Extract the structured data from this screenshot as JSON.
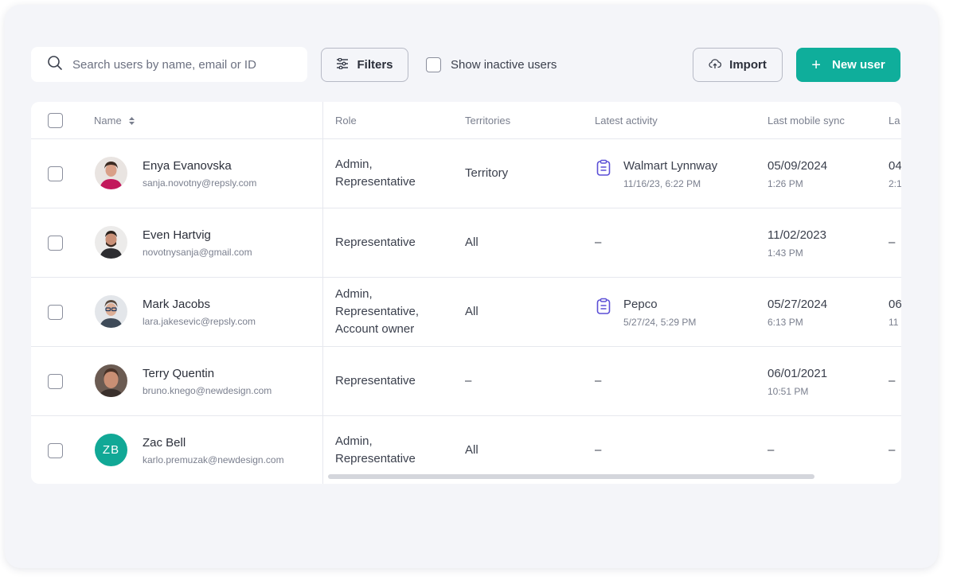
{
  "toolbar": {
    "search_placeholder": "Search users by name, email or ID",
    "filters_label": "Filters",
    "show_inactive_label": "Show inactive users",
    "import_label": "Import",
    "new_user_label": "New user"
  },
  "table": {
    "columns": {
      "name": "Name",
      "role": "Role",
      "territories": "Territories",
      "latest_activity": "Latest activity",
      "last_mobile_sync": "Last mobile sync",
      "last_partial": "La"
    },
    "rows": [
      {
        "name": "Enya Evanovska",
        "email": "sanja.novotny@repsly.com",
        "role_lines": [
          "Admin,",
          "Representative",
          ""
        ],
        "territories": "Territory",
        "activity_title": "Walmart Lynnway",
        "activity_time": "11/16/23, 6:22 PM",
        "sync_date": "05/09/2024",
        "sync_time": "1:26 PM",
        "last_top": "04",
        "last_bottom": "2:1"
      },
      {
        "name": "Even Hartvig",
        "email": "novotnysanja@gmail.com",
        "role_lines": [
          "Representative",
          "",
          ""
        ],
        "territories": "All",
        "activity_dash": "–",
        "sync_date": "11/02/2023",
        "sync_time": "1:43 PM",
        "last_dash": "–"
      },
      {
        "name": "Mark Jacobs",
        "email": "lara.jakesevic@repsly.com",
        "role_lines": [
          "Admin,",
          "Representative,",
          "Account owner"
        ],
        "territories": "All",
        "activity_title": "Pepco",
        "activity_time": "5/27/24, 5:29 PM",
        "sync_date": "05/27/2024",
        "sync_time": "6:13 PM",
        "last_top": "06",
        "last_bottom": "11"
      },
      {
        "name": "Terry Quentin",
        "email": "bruno.knego@newdesign.com",
        "role_lines": [
          "Representative",
          "",
          ""
        ],
        "territories": "–",
        "activity_dash": "–",
        "sync_date": "06/01/2021",
        "sync_time": "10:51 PM",
        "last_dash": "–"
      },
      {
        "name": "Zac Bell",
        "initials": "ZB",
        "email": "karlo.premuzak@newdesign.com",
        "role_lines": [
          "Admin,",
          "Representative",
          ""
        ],
        "territories": "All",
        "activity_dash": "–",
        "sync_dash": "–",
        "last_dash": "–"
      }
    ]
  },
  "colors": {
    "accent": "#0fae9b",
    "activity_icon": "#5b4fd6"
  }
}
